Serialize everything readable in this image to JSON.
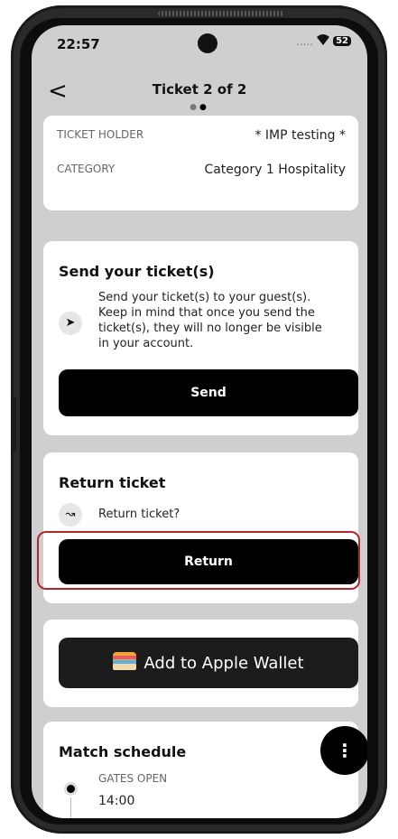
{
  "status": {
    "time": "22:57",
    "signal": ".....",
    "wifi": "▾",
    "battery": "52"
  },
  "header": {
    "back_label": "<",
    "title": "Ticket 2 of 2",
    "pager_dots": "•●"
  },
  "ticket": {
    "holder_label": "TICKET HOLDER",
    "holder_value": "* IMP testing  *",
    "category_label": "CATEGORY",
    "category_value": "Category 1 Hospitality"
  },
  "send": {
    "title": "Send your ticket(s)",
    "icon": "send-arrow",
    "line1": "Send your ticket(s) to your guest(s).",
    "line2": "Keep in mind that once you send the",
    "line3": "ticket(s), they will no longer be visible",
    "line4": "in your account.",
    "button_label": "Send"
  },
  "return": {
    "title": "Return ticket",
    "icon": "return-arrow",
    "question": "Return ticket?",
    "button_label": "Return"
  },
  "wallet": {
    "button_label": "Add to Apple Wallet",
    "icon": "wallet-icon"
  },
  "schedule": {
    "title": "Match schedule",
    "gates_label": "GATES OPEN",
    "gates_time": "14:00"
  },
  "fab": {
    "label": "⋮"
  }
}
